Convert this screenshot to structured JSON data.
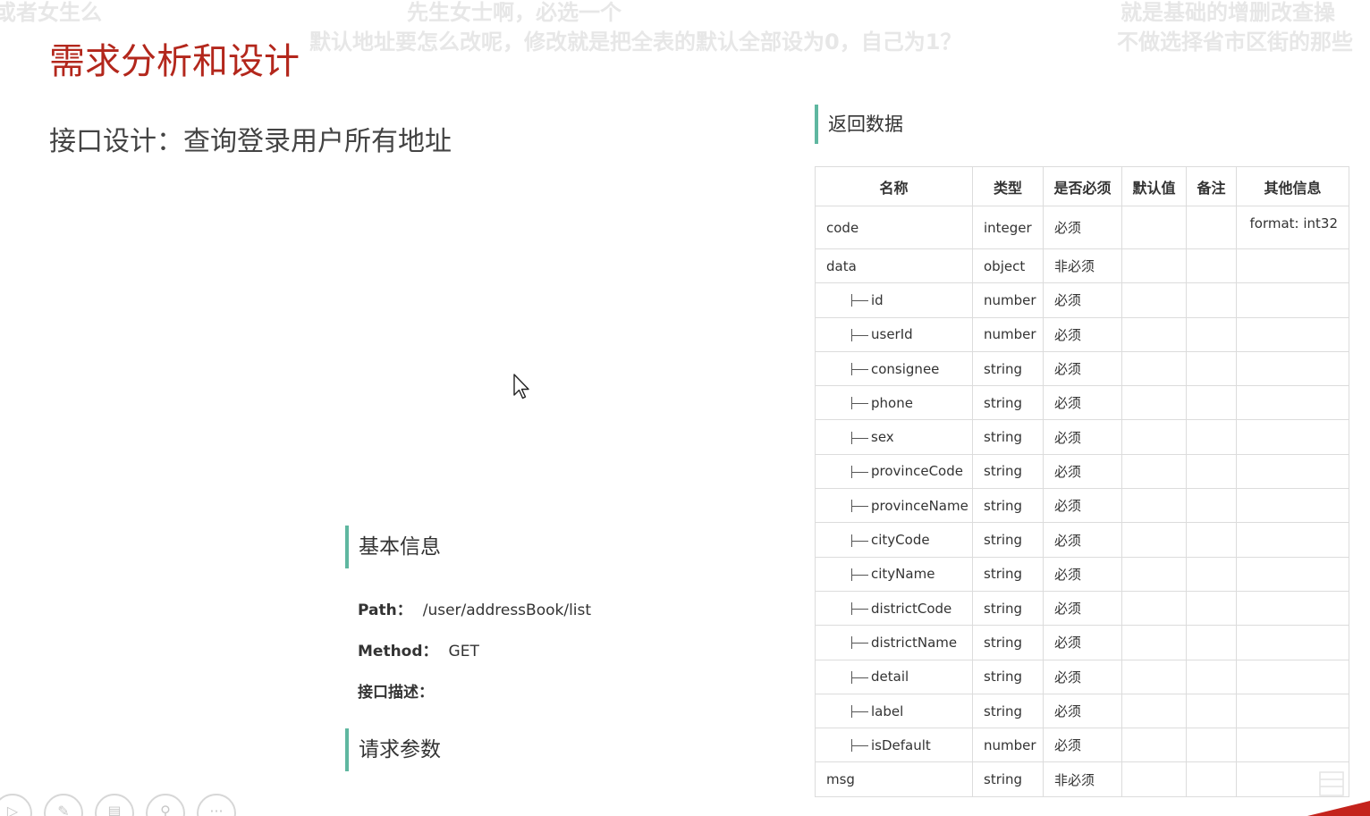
{
  "danmaku": [
    "或者女生么",
    "先生女士啊，必选一个",
    "默认地址要怎么改呢，修改就是把全表的默认全部设为0，自己为1？",
    "就是基础的增删改查操",
    "不做选择省市区街的那些"
  ],
  "slide": {
    "title": "需求分析和设计",
    "subtitle": "接口设计：查询登录用户所有地址"
  },
  "basic_info": {
    "heading": "基本信息",
    "path_label": "Path：",
    "path_value": "/user/addressBook/list",
    "method_label": "Method：",
    "method_value": "GET",
    "desc_label": "接口描述："
  },
  "request_params": {
    "heading": "请求参数"
  },
  "return_data": {
    "heading": "返回数据",
    "columns": [
      "名称",
      "类型",
      "是否必须",
      "默认值",
      "备注",
      "其他信息"
    ],
    "rows": [
      {
        "name": "code",
        "type": "integer",
        "required": "必须",
        "default": "",
        "note": "",
        "other": "format: int32",
        "child": false
      },
      {
        "name": "data",
        "type": "object",
        "required": "非必须",
        "default": "",
        "note": "",
        "other": "",
        "child": false
      },
      {
        "name": "id",
        "type": "number",
        "required": "必须",
        "default": "",
        "note": "",
        "other": "",
        "child": true
      },
      {
        "name": "userId",
        "type": "number",
        "required": "必须",
        "default": "",
        "note": "",
        "other": "",
        "child": true
      },
      {
        "name": "consignee",
        "type": "string",
        "required": "必须",
        "default": "",
        "note": "",
        "other": "",
        "child": true
      },
      {
        "name": "phone",
        "type": "string",
        "required": "必须",
        "default": "",
        "note": "",
        "other": "",
        "child": true
      },
      {
        "name": "sex",
        "type": "string",
        "required": "必须",
        "default": "",
        "note": "",
        "other": "",
        "child": true
      },
      {
        "name": "provinceCode",
        "type": "string",
        "required": "必须",
        "default": "",
        "note": "",
        "other": "",
        "child": true
      },
      {
        "name": "provinceName",
        "type": "string",
        "required": "必须",
        "default": "",
        "note": "",
        "other": "",
        "child": true
      },
      {
        "name": "cityCode",
        "type": "string",
        "required": "必须",
        "default": "",
        "note": "",
        "other": "",
        "child": true
      },
      {
        "name": "cityName",
        "type": "string",
        "required": "必须",
        "default": "",
        "note": "",
        "other": "",
        "child": true
      },
      {
        "name": "districtCode",
        "type": "string",
        "required": "必须",
        "default": "",
        "note": "",
        "other": "",
        "child": true
      },
      {
        "name": "districtName",
        "type": "string",
        "required": "必须",
        "default": "",
        "note": "",
        "other": "",
        "child": true
      },
      {
        "name": "detail",
        "type": "string",
        "required": "必须",
        "default": "",
        "note": "",
        "other": "",
        "child": true
      },
      {
        "name": "label",
        "type": "string",
        "required": "必须",
        "default": "",
        "note": "",
        "other": "",
        "child": true
      },
      {
        "name": "isDefault",
        "type": "number",
        "required": "必须",
        "default": "",
        "note": "",
        "other": "",
        "child": true
      },
      {
        "name": "msg",
        "type": "string",
        "required": "非必须",
        "default": "",
        "note": "",
        "other": "",
        "child": false
      }
    ]
  },
  "toolbar": {
    "icons": [
      "play-icon",
      "pen-icon",
      "slides-icon",
      "zoom-icon",
      "more-icon"
    ],
    "glyphs": [
      "▷",
      "✎",
      "▤",
      "⚲",
      "···"
    ]
  },
  "colors": {
    "title_red": "#b3271c",
    "accent_green": "#5fb7a0"
  }
}
